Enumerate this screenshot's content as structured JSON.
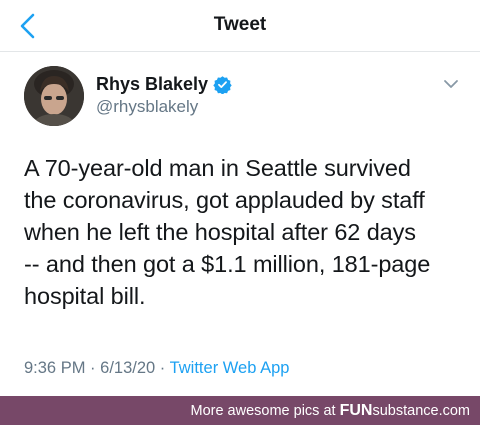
{
  "nav": {
    "title": "Tweet",
    "back_icon": "chevron-left-icon"
  },
  "tweet": {
    "author_name": "Rhys Blakely",
    "handle": "@rhysblakely",
    "verified_icon": "verified-badge-icon",
    "menu_icon": "chevron-down-icon",
    "text_lines": [
      "A 70-year-old man in Seattle survived",
      "the coronavirus, got applauded by staff",
      "when he left the hospital after 62 days",
      "-- and then got a $1.1 million, 181-page",
      "hospital bill."
    ],
    "time": "9:36 PM",
    "separator": "·",
    "date": "6/13/20",
    "source": "Twitter Web App"
  },
  "footer": {
    "text": "More awesome pics at",
    "brand_fun": "FUN",
    "brand_rest": "substance.com"
  },
  "colors": {
    "accent": "#1da1f2",
    "muted": "#657786",
    "footer_bg": "#774868"
  }
}
